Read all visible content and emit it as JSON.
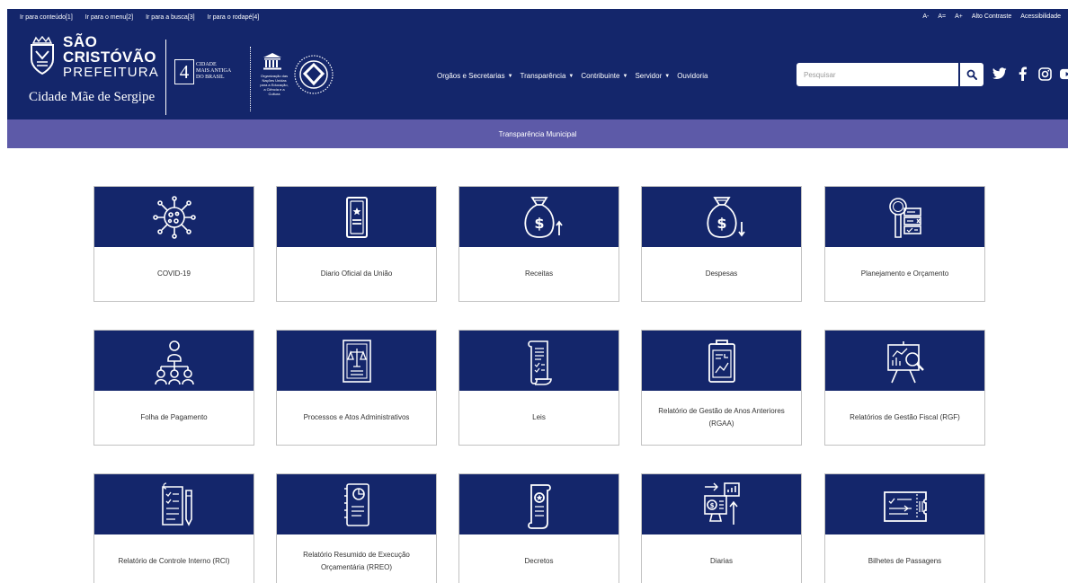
{
  "skip_links": [
    "Ir para conteúdo[1]",
    "Ir para o menu[2]",
    "Ir para a busca[3]",
    "Ir para o rodapé[4]"
  ],
  "accessibility": [
    "A-",
    "A=",
    "A+",
    "Alto Contraste",
    "Acessibilidade"
  ],
  "logo": {
    "line1": "SÃO",
    "line2": "CRISTÓVÃO",
    "line3": "PREFEITURA",
    "tagline": "Cidade Mãe de Sergipe"
  },
  "badge400": {
    "number": "4",
    "line1": "CIDADE",
    "line2": "MAIS ANTIGA",
    "line3": "DO BRASIL"
  },
  "unesco_text": "Organização das Nações Unidas para a Educação, a Ciência e a Cultura",
  "nav": [
    {
      "label": "Orgãos e Secretarias",
      "dropdown": true
    },
    {
      "label": "Transparência",
      "dropdown": true
    },
    {
      "label": "Contribuinte",
      "dropdown": true
    },
    {
      "label": "Servidor",
      "dropdown": true
    },
    {
      "label": "Ouvidoria",
      "dropdown": false
    }
  ],
  "search": {
    "placeholder": "Pesquisar",
    "icon": "search-icon"
  },
  "social_icons": [
    "twitter-icon",
    "facebook-icon",
    "instagram-icon",
    "youtube-icon"
  ],
  "subnav_title": "Transparência Municipal",
  "colors": {
    "header": "#14266b",
    "subnav": "#5d5aa8",
    "card_border": "#c2c2c2"
  },
  "cards": [
    {
      "label": "COVID-19",
      "icon": "virus-icon"
    },
    {
      "label": "Diario Oficial da União",
      "icon": "official-document-icon"
    },
    {
      "label": "Receitas",
      "icon": "money-bag-up-icon"
    },
    {
      "label": "Despesas",
      "icon": "money-bag-down-icon"
    },
    {
      "label": "Planejamento e Orçamento",
      "icon": "planning-checklist-icon"
    },
    {
      "label": "Folha de Pagamento",
      "icon": "team-hierarchy-icon"
    },
    {
      "label": "Processos e Atos Administrativos",
      "icon": "justice-scale-document-icon"
    },
    {
      "label": "Leis",
      "icon": "law-scroll-icon"
    },
    {
      "label": "Relatório de Gestão de Anos Anteriores (RGAA)",
      "icon": "clipboard-report-icon"
    },
    {
      "label": "Relatórios de Gestão Fiscal (RGF)",
      "icon": "fiscal-chart-magnifier-icon"
    },
    {
      "label": "Relatório de Controle Interno (RCI)",
      "icon": "checklist-pen-icon"
    },
    {
      "label": "Relatório Resumido de Execução Orçamentária (RREO)",
      "icon": "pie-chart-notebook-icon"
    },
    {
      "label": "Decretos",
      "icon": "decree-scroll-icon"
    },
    {
      "label": "Diarias",
      "icon": "finance-monitor-icon"
    },
    {
      "label": "Bilhetes de Passagens",
      "icon": "ticket-icon"
    }
  ]
}
